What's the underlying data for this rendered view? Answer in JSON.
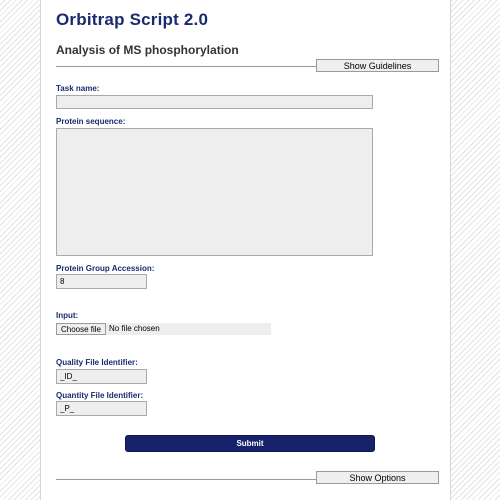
{
  "app": {
    "title": "Orbitrap Script 2.0",
    "subtitle": "Analysis of MS phosphorylation"
  },
  "header": {
    "guidelines_button": "Show Guidelines"
  },
  "form": {
    "task_name": {
      "label": "Task name:",
      "value": ""
    },
    "protein_sequence": {
      "label": "Protein sequence:",
      "value": ""
    },
    "protein_group_accession": {
      "label": "Protein Group Accession:",
      "value": "8"
    },
    "input": {
      "label": "Input:",
      "choose_button": "Choose file",
      "status": "No file chosen"
    },
    "quality_file_identifier": {
      "label": "Quality File Identifier:",
      "value": "_ID_"
    },
    "quantity_file_identifier": {
      "label": "Quantity File Identifier:",
      "value": "_P_"
    },
    "submit_button": "Submit"
  },
  "footer": {
    "options_button": "Show Options"
  },
  "colors": {
    "title": "#1a2a6e",
    "submit_background": "#16236b",
    "field_background": "#eeeeee"
  }
}
